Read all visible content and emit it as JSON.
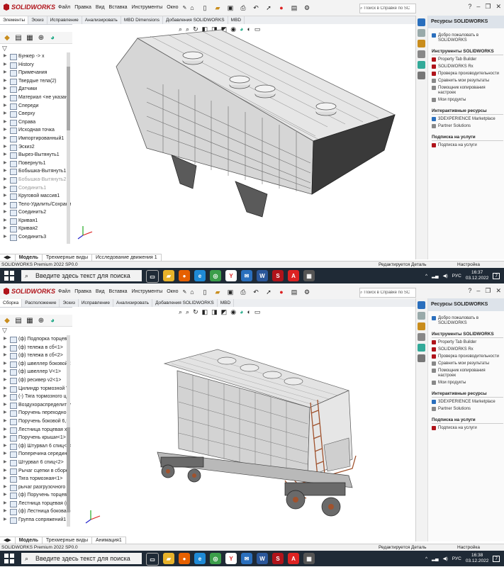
{
  "colors": {
    "sw_red": "#b0131a",
    "taskbar": "#1f2a36",
    "model_grey": "#d9d9d9"
  },
  "windows": [
    {
      "brand": "SOLIDWORKS",
      "menu": [
        "Файл",
        "Правка",
        "Вид",
        "Вставка",
        "Инструменты",
        "Окно"
      ],
      "search_placeholder": "Поиск в Справке по SC",
      "command_tabs": [
        "Элементы",
        "Эскиз",
        "Исправление",
        "Анализировать",
        "MBD Dimensions",
        "Добавления SOLIDWORKS",
        "MBD"
      ],
      "tree": [
        {
          "label": "Бункер -> x",
          "dim": false
        },
        {
          "label": "History",
          "dim": false
        },
        {
          "label": "Примечания",
          "dim": false
        },
        {
          "label": "Твердые тела(2)",
          "dim": false
        },
        {
          "label": "Датчики",
          "dim": false
        },
        {
          "label": "Материал <не указан",
          "dim": false
        },
        {
          "label": "Спереди",
          "dim": false
        },
        {
          "label": "Сверху",
          "dim": false
        },
        {
          "label": "Справа",
          "dim": false
        },
        {
          "label": "Исходная точка",
          "dim": false
        },
        {
          "label": "Импортированный1",
          "dim": false
        },
        {
          "label": "Эскиз2",
          "dim": false
        },
        {
          "label": "Вырез-Вытянуть1",
          "dim": false
        },
        {
          "label": "Повернуть1",
          "dim": false
        },
        {
          "label": "Бобышка-Вытянуть1",
          "dim": false
        },
        {
          "label": "Бобышка-Вытянуть2",
          "dim": true
        },
        {
          "label": "Соединить1",
          "dim": true
        },
        {
          "label": "Круговой массив1",
          "dim": false
        },
        {
          "label": "Тело-Удалить/Сохрани",
          "dim": false
        },
        {
          "label": "Соединить2",
          "dim": false
        },
        {
          "label": "Кривая1",
          "dim": false
        },
        {
          "label": "Кривая2",
          "dim": false
        },
        {
          "label": "Соединить3",
          "dim": false
        }
      ],
      "bottom_tabs": [
        "Модель",
        "Трехмерные виды",
        "Исследование движения 1"
      ],
      "status_left": "SOLIDWORKS Premium 2022 SP0.0",
      "status_mid": "Редактируется Деталь",
      "status_right": "Настройка",
      "task_title": "Ресурсы SOLIDWORKS",
      "welcome": "Добро пожаловать в SOLIDWORKS",
      "sec_tools": "Инструменты SOLIDWORKS",
      "tools": [
        "Property Tab Builder",
        "SOLIDWORKS Rx",
        "Проверка производительности",
        "Сравнить мои результаты",
        "Помощник копирования настроек",
        "Мои продукты"
      ],
      "sec_interactive": "Интерактивные ресурсы",
      "interactive": [
        "3DEXPERIENCE Marketplace",
        "Partner Solutions"
      ],
      "sec_sub": "Подписка на услуги",
      "sub": [
        "Подписка на услуги"
      ],
      "taskbar_search": "Введите здесь текст для поиска",
      "lang": "РУС",
      "time": "16:37",
      "date": "03.12.2022"
    },
    {
      "brand": "SOLIDWORKS",
      "menu": [
        "Файл",
        "Правка",
        "Вид",
        "Вставка",
        "Инструменты",
        "Окно"
      ],
      "search_placeholder": "Поиск в Справке по SC",
      "command_tabs": [
        "Сборка",
        "Расположение",
        "Эскиз",
        "Исправление",
        "Анализировать",
        "Добавления SOLIDWORKS",
        "MBD"
      ],
      "tree": [
        {
          "label": "(ф) Подпорка торцева",
          "dim": false
        },
        {
          "label": "(ф) тележа в сб<1>",
          "dim": false
        },
        {
          "label": "(ф) тележа в сб<2>",
          "dim": false
        },
        {
          "label": "(ф) швеллер боковой<",
          "dim": false
        },
        {
          "label": "(ф) швеллер V<1>",
          "dim": false
        },
        {
          "label": "(ф) ресивер v2<1>",
          "dim": false
        },
        {
          "label": "Цилиндр тормозной V.",
          "dim": false
        },
        {
          "label": "(-) Тяга тормозного ци",
          "dim": false
        },
        {
          "label": "Воздухораспределител",
          "dim": false
        },
        {
          "label": "Поручень переходной",
          "dim": false
        },
        {
          "label": "Поручень боковой 6,5",
          "dim": false
        },
        {
          "label": "Лестница торцевая хо",
          "dim": false
        },
        {
          "label": "Поручень крыши<1>",
          "dim": false
        },
        {
          "label": "(ф) Штурвал 6 спиц<1>",
          "dim": false
        },
        {
          "label": "Поперечина середин",
          "dim": false
        },
        {
          "label": "Штурвал 6 спиц<2>",
          "dim": false
        },
        {
          "label": "Рычаг сцепки в сборе",
          "dim": false
        },
        {
          "label": "Тяга тормозная<1>",
          "dim": false
        },
        {
          "label": "рычаг разгрузочного",
          "dim": false
        },
        {
          "label": "(ф) Поручень торцево",
          "dim": false
        },
        {
          "label": "Лестница торцевая (п",
          "dim": false
        },
        {
          "label": "(ф) Лестница боковая (",
          "dim": false
        },
        {
          "label": "Группа сопряжений1",
          "dim": false
        }
      ],
      "bottom_tabs": [
        "Модель",
        "Трехмерные виды",
        "Анимация1"
      ],
      "status_left": "SOLIDWORKS Premium 2022 SP0.0",
      "status_mid": "Редактируется Деталь",
      "status_right": "Настройка",
      "task_title": "Ресурсы SOLIDWORKS",
      "welcome": "Добро пожаловать в SOLIDWORKS",
      "sec_tools": "Инструменты SOLIDWORKS",
      "tools": [
        "Property Tab Builder",
        "SOLIDWORKS Rx",
        "Проверка производительности",
        "Сравнить мои результаты",
        "Помощник копирования настроек",
        "Мои продукты"
      ],
      "sec_interactive": "Интерактивные ресурсы",
      "interactive": [
        "3DEXPERIENCE Marketplace",
        "Partner Solutions"
      ],
      "sec_sub": "Подписка на услуги",
      "sub": [
        "Подписка на услуги"
      ],
      "taskbar_search": "Введите здесь текст для поиска",
      "lang": "РУС",
      "time": "16:38",
      "date": "03.12.2022"
    }
  ]
}
